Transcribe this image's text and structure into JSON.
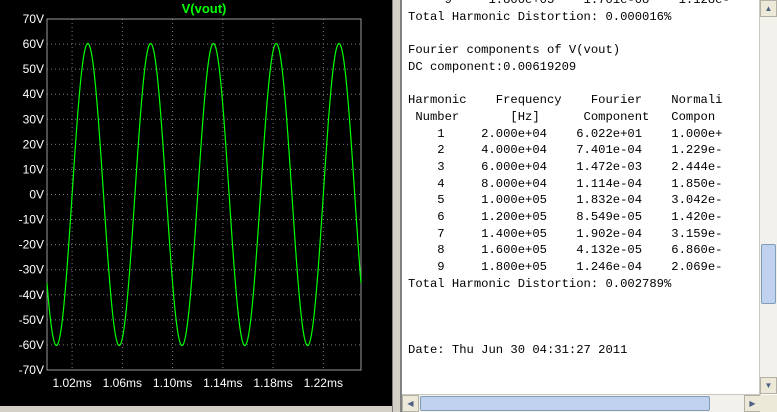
{
  "chart_data": {
    "type": "line",
    "title": "V(vout)",
    "xlabel": "",
    "ylabel": "",
    "x_ticks": [
      "1.02ms",
      "1.06ms",
      "1.10ms",
      "1.14ms",
      "1.18ms",
      "1.22ms"
    ],
    "x_tick_values": [
      1.02,
      1.06,
      1.1,
      1.14,
      1.18,
      1.22
    ],
    "y_ticks": [
      "70V",
      "60V",
      "50V",
      "40V",
      "30V",
      "20V",
      "10V",
      "0V",
      "-10V",
      "-20V",
      "-30V",
      "-40V",
      "-50V",
      "-60V",
      "-70V"
    ],
    "y_tick_values": [
      70,
      60,
      50,
      40,
      30,
      20,
      10,
      0,
      -10,
      -20,
      -30,
      -40,
      -50,
      -60,
      -70
    ],
    "xlim": [
      1.0,
      1.25
    ],
    "ylim": [
      -70,
      70
    ],
    "grid": true,
    "series": [
      {
        "name": "V(vout)",
        "color": "#00ff00",
        "amplitude": 60.22,
        "frequency_hz": 20000,
        "x_units": "ms",
        "x_peaks": [
          1.0325,
          1.0825,
          1.1325,
          1.1825
        ]
      }
    ]
  },
  "colors": {
    "plot_background": "#000000",
    "grid": "#7a7a7a",
    "trace": "#00ff00",
    "axis_text": "#ffffff"
  },
  "output": {
    "lines": [
      "     9     1.800e+05    1.701e-08    1.128e-",
      "Total Harmonic Distortion: 0.000016%",
      "",
      "Fourier components of V(vout)",
      "DC component:0.00619209",
      "",
      "Harmonic    Frequency    Fourier    Normali",
      " Number       [Hz]      Component   Compon",
      "    1     2.000e+04    6.022e+01    1.000e+",
      "    2     4.000e+04    7.401e-04    1.229e-",
      "    3     6.000e+04    1.472e-03    2.444e-",
      "    4     8.000e+04    1.114e-04    1.850e-",
      "    5     1.000e+05    1.832e-04    3.042e-",
      "    6     1.200e+05    8.549e-05    1.420e-",
      "    7     1.400e+05    1.902e-04    3.159e-",
      "    8     1.600e+05    4.132e-05    6.860e-",
      "    9     1.800e+05    1.246e-04    2.069e-",
      "Total Harmonic Distortion: 0.002789%",
      "",
      "",
      "",
      "Date: Thu Jun 30 04:31:27 2011"
    ]
  },
  "scrollbars": {
    "up_arrow": "▲",
    "down_arrow": "▼",
    "left_arrow": "◀",
    "right_arrow": "▶"
  }
}
